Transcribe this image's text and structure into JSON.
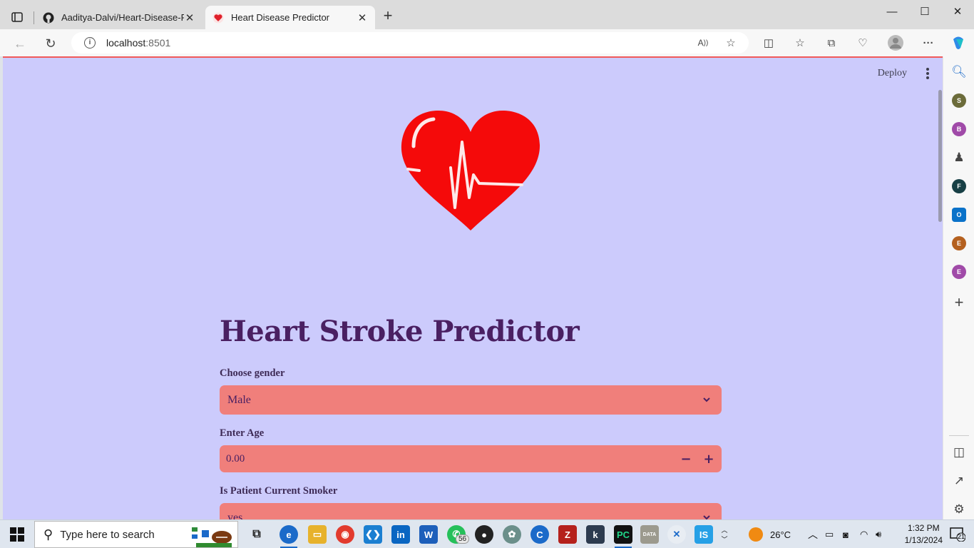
{
  "browser": {
    "tabs": [
      {
        "title": "Aaditya-Dalvi/Heart-Disease-Pre",
        "active": false,
        "favicon": "github-icon"
      },
      {
        "title": "Heart Disease Predictor",
        "active": true,
        "favicon": "heart-icon"
      }
    ],
    "url_host": "localhost",
    "url_port": ":8501"
  },
  "app": {
    "deploy_label": "Deploy",
    "title": "Heart Stroke Predictor",
    "gender": {
      "label": "Choose gender",
      "value": "Male"
    },
    "age": {
      "label": "Enter Age",
      "value": "0.00",
      "minus": "−",
      "plus": "+"
    },
    "smoker": {
      "label": "Is Patient Current Smoker",
      "value": "yes"
    }
  },
  "sidebar": {
    "profiles": [
      {
        "letter": "S",
        "color": "#6b6b3a"
      },
      {
        "letter": "B",
        "color": "#a04aa8"
      },
      {
        "letter": "F",
        "color": "#173f45"
      },
      {
        "letter": "E",
        "color": "#b4601f"
      },
      {
        "letter": "E",
        "color": "#a04aa8"
      }
    ]
  },
  "taskbar": {
    "search_placeholder": "Type here to search",
    "whatsapp_badge": "56",
    "weather": "26°C",
    "time": "1:32 PM",
    "date": "1/13/2024",
    "notifications": "21"
  },
  "colors": {
    "page_bg": "#cccbfc",
    "widget_bg": "#f07f7b",
    "title_color": "#4a2062",
    "heart_red": "#f50a0a"
  }
}
